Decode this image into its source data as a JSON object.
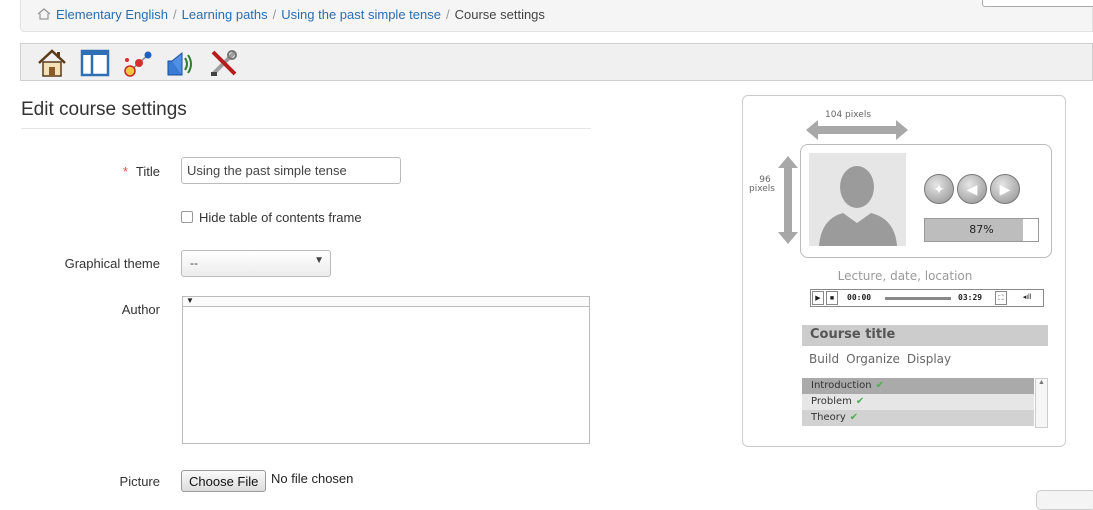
{
  "breadcrumb": {
    "items": [
      "Elementary English",
      "Learning paths",
      "Using the past simple tense"
    ],
    "current": "Course settings",
    "separator": "/"
  },
  "toolbar": {
    "icons": [
      "home-icon",
      "layout-icon",
      "molecule-icon",
      "audio-icon",
      "tools-icon"
    ]
  },
  "page": {
    "title": "Edit course settings"
  },
  "form": {
    "title_required": "*",
    "title_label": "Title",
    "title_value": "Using the past simple tense",
    "hide_toc_label": "Hide table of contents frame",
    "hide_toc_checked": false,
    "theme_label": "Graphical theme",
    "theme_value": "--",
    "author_label": "Author",
    "author_value": "",
    "picture_label": "Picture",
    "choose_file_label": "Choose File",
    "no_file_text": "No file chosen"
  },
  "preview": {
    "width_label": "104 pixels",
    "height_value": "96",
    "height_unit": "pixels",
    "progress_text": "87%",
    "progress_value": 87,
    "lecture_text": "Lecture, date, location",
    "time_start": "00:00",
    "time_end": "03:29",
    "course_title": "Course title",
    "menu": [
      "Build",
      "Organize",
      "Display"
    ],
    "toc": [
      "Introduction",
      "Problem",
      "Theory"
    ]
  },
  "colors": {
    "link": "#2a6db0",
    "required": "#d9534f",
    "check": "#4caf50",
    "panel_grey": "#cccccc"
  }
}
